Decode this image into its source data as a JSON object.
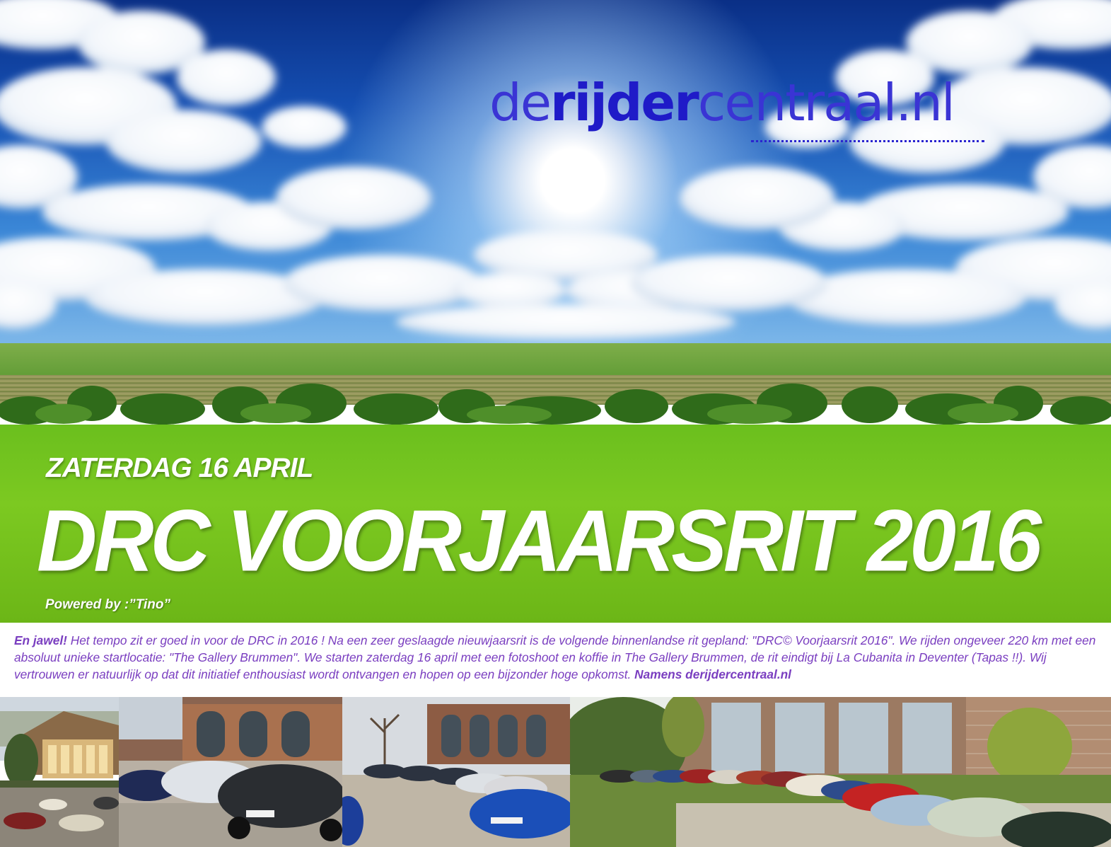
{
  "brand": {
    "logo_prefix": "de",
    "logo_bold": "rijder",
    "logo_suffix": "centraal.nl",
    "colors": {
      "logo": "#3a34d4",
      "intro_text": "#7a3ec0",
      "sky_top": "#0a2f86",
      "grass": "#7cc921"
    }
  },
  "hero": {
    "date": "ZATERDAG 16 APRIL",
    "title": "DRC VOORJAARSRIT 2016",
    "powered_by": "Powered by :”Tino”"
  },
  "intro": {
    "lead": "En jawel!",
    "body": " Het tempo zit er goed in voor de DRC in 2016 ! Na een zeer geslaagde nieuwjaarsrit is de volgende binnenlandse rit gepland: \"DRC© Voorjaarsrit 2016\". We rijden ongeveer 220 km met een absoluut unieke startlocatie: \"The Gallery Brummen\". We starten zaterdag 16 april met een fotoshoot en koffie in The Gallery Brummen, de rit eindigt bij La Cubanita in Deventer (Tapas !!). Wij vertrouwen er natuurlijk op dat dit initiatief enthousiast wordt  ontvangen en hopen op een bijzonder hoge opkomst. ",
    "signature": "Namens derijdercentraal.nl"
  },
  "photos": [
    {
      "name": "gallery-building-classic-cars"
    },
    {
      "name": "volkswagen-scirocco-row"
    },
    {
      "name": "parked-cars-lineup"
    },
    {
      "name": "classic-sports-cars-row"
    }
  ]
}
